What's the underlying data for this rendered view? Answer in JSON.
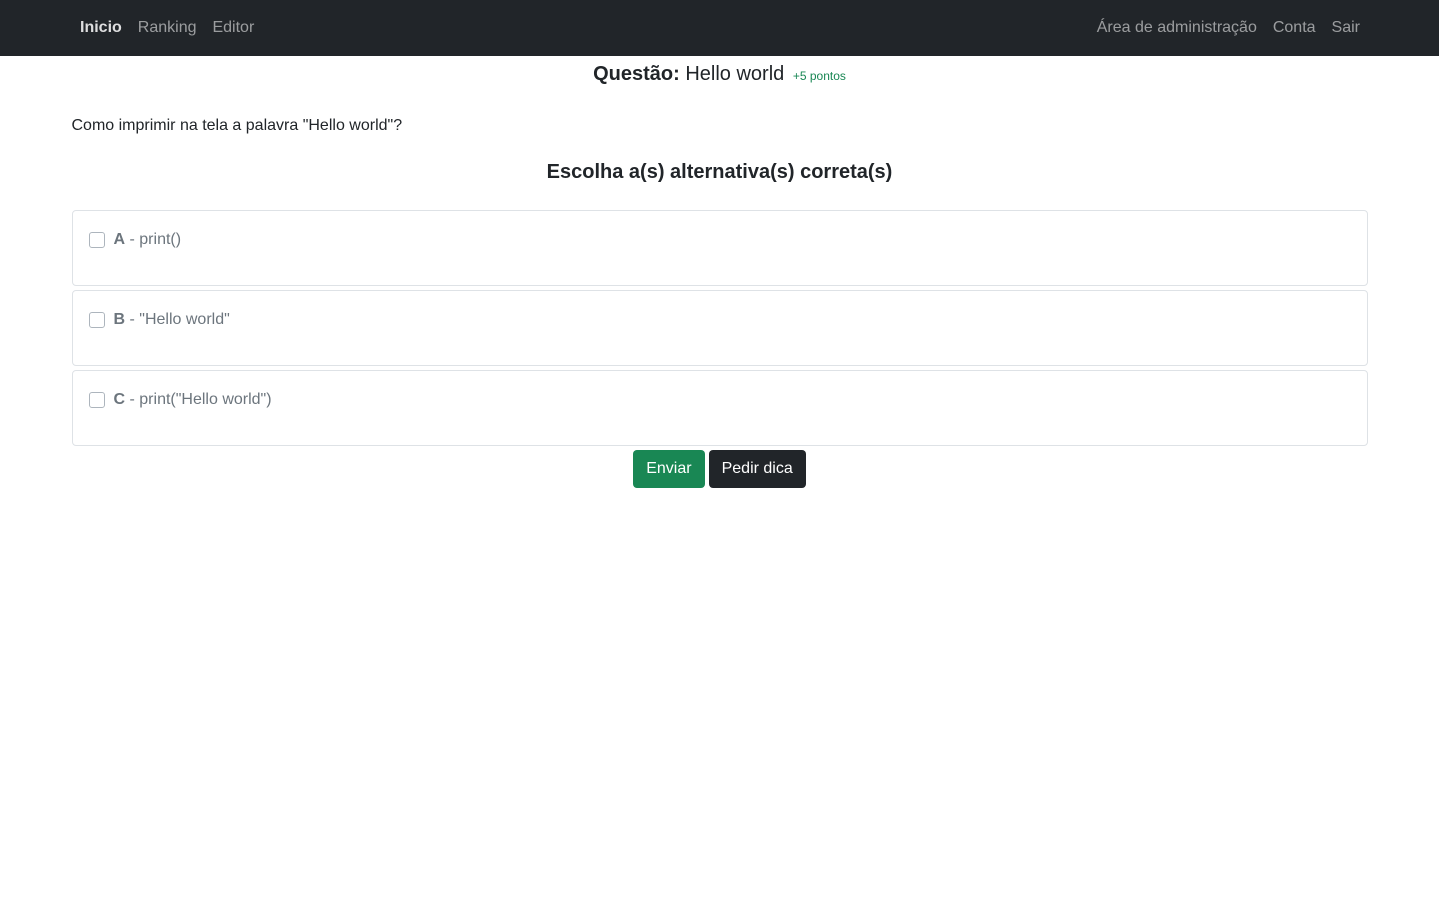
{
  "navbar": {
    "left": [
      "Inicio",
      "Ranking",
      "Editor"
    ],
    "right": [
      "Área de administração",
      "Conta",
      "Sair"
    ]
  },
  "question": {
    "label": "Questão:",
    "name": "Hello world",
    "points": "+5 pontos",
    "text": "Como imprimir na tela a palavra \"Hello world\"?"
  },
  "choose_heading": "Escolha a(s) alternativa(s) correta(s)",
  "options": [
    {
      "letter": "A",
      "text": " - print()",
      "checked": false
    },
    {
      "letter": "B",
      "text": " - \"Hello world\"",
      "checked": false
    },
    {
      "letter": "C",
      "text": " - print(\"Hello world\")",
      "checked": false
    }
  ],
  "buttons": {
    "submit": "Enviar",
    "hint": "Pedir dica"
  },
  "colors": {
    "navbar_bg": "#212529",
    "success": "#198754",
    "dark": "#212529"
  }
}
